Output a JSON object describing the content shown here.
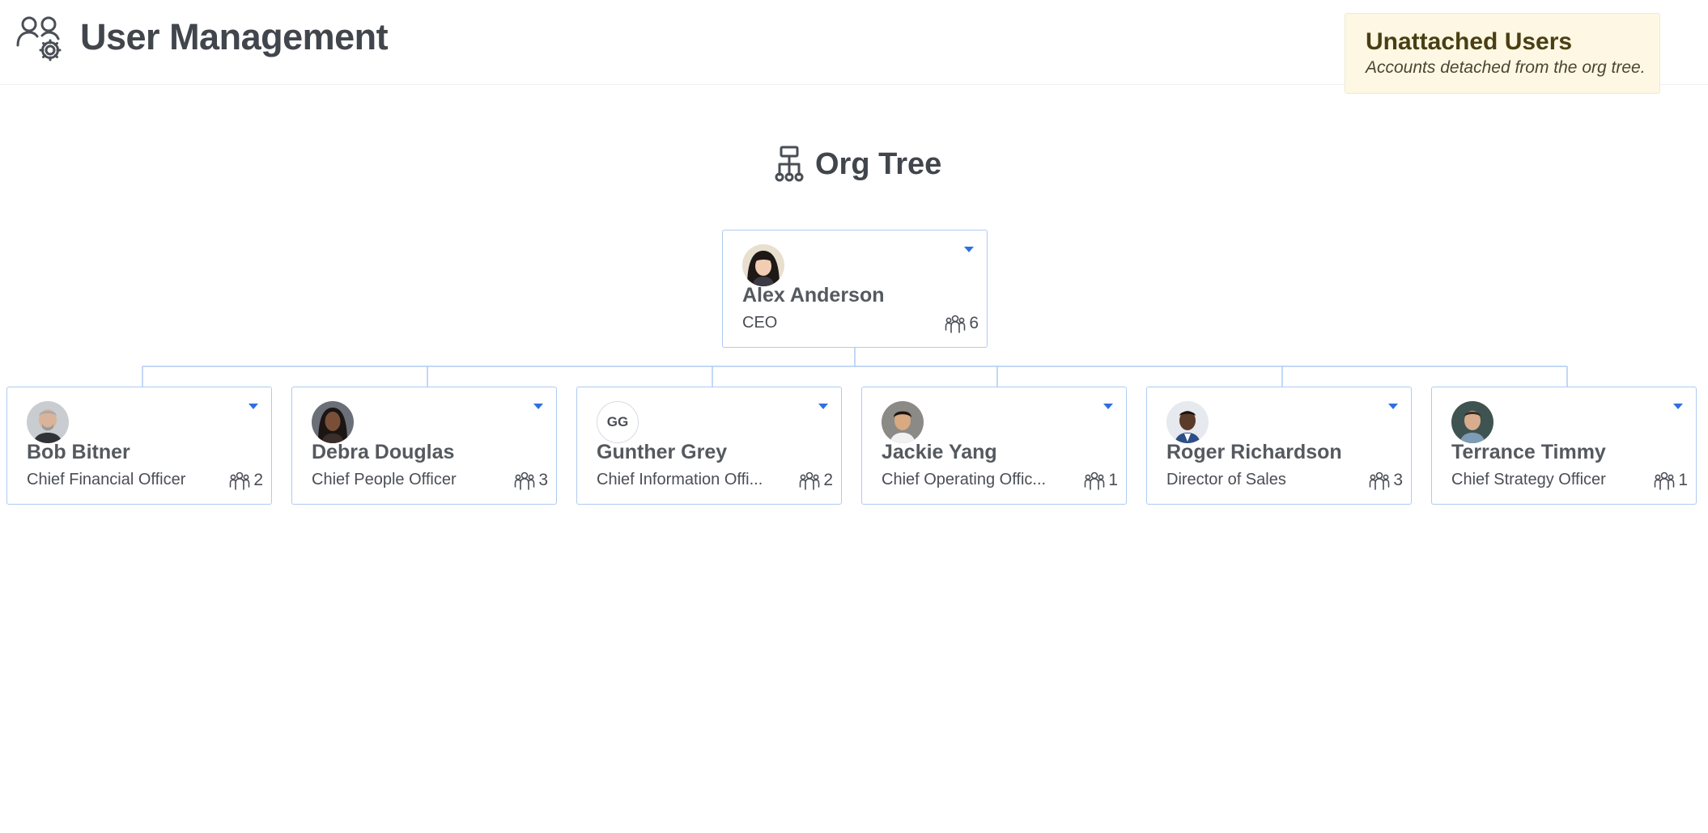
{
  "header": {
    "title": "User Management",
    "icon": "users-gear-icon"
  },
  "unattached": {
    "title": "Unattached Users",
    "subtitle": "Accounts detached from the org tree."
  },
  "tree": {
    "title": "Org Tree",
    "icon": "hierarchy-icon"
  },
  "colors": {
    "card_border": "#aecbf2",
    "connector": "#aecbf2",
    "dropdown": "#2f6fe0",
    "unattached_bg": "#fdf7e3"
  },
  "root": {
    "name": "Alex Anderson",
    "role": "CEO",
    "reports": "6",
    "avatar": "photo"
  },
  "children": [
    {
      "name": "Bob Bitner",
      "role": "Chief Financial Officer",
      "reports": "2",
      "avatar": "photo"
    },
    {
      "name": "Debra Douglas",
      "role": "Chief People Officer",
      "reports": "3",
      "avatar": "photo"
    },
    {
      "name": "Gunther Grey",
      "role": "Chief Information Offi...",
      "reports": "2",
      "avatar": "initials",
      "initials": "GG"
    },
    {
      "name": "Jackie Yang",
      "role": "Chief Operating Offic...",
      "reports": "1",
      "avatar": "photo"
    },
    {
      "name": "Roger Richardson",
      "role": "Director of Sales",
      "reports": "3",
      "avatar": "photo"
    },
    {
      "name": "Terrance Timmy",
      "role": "Chief Strategy Officer",
      "reports": "1",
      "avatar": "photo"
    }
  ]
}
